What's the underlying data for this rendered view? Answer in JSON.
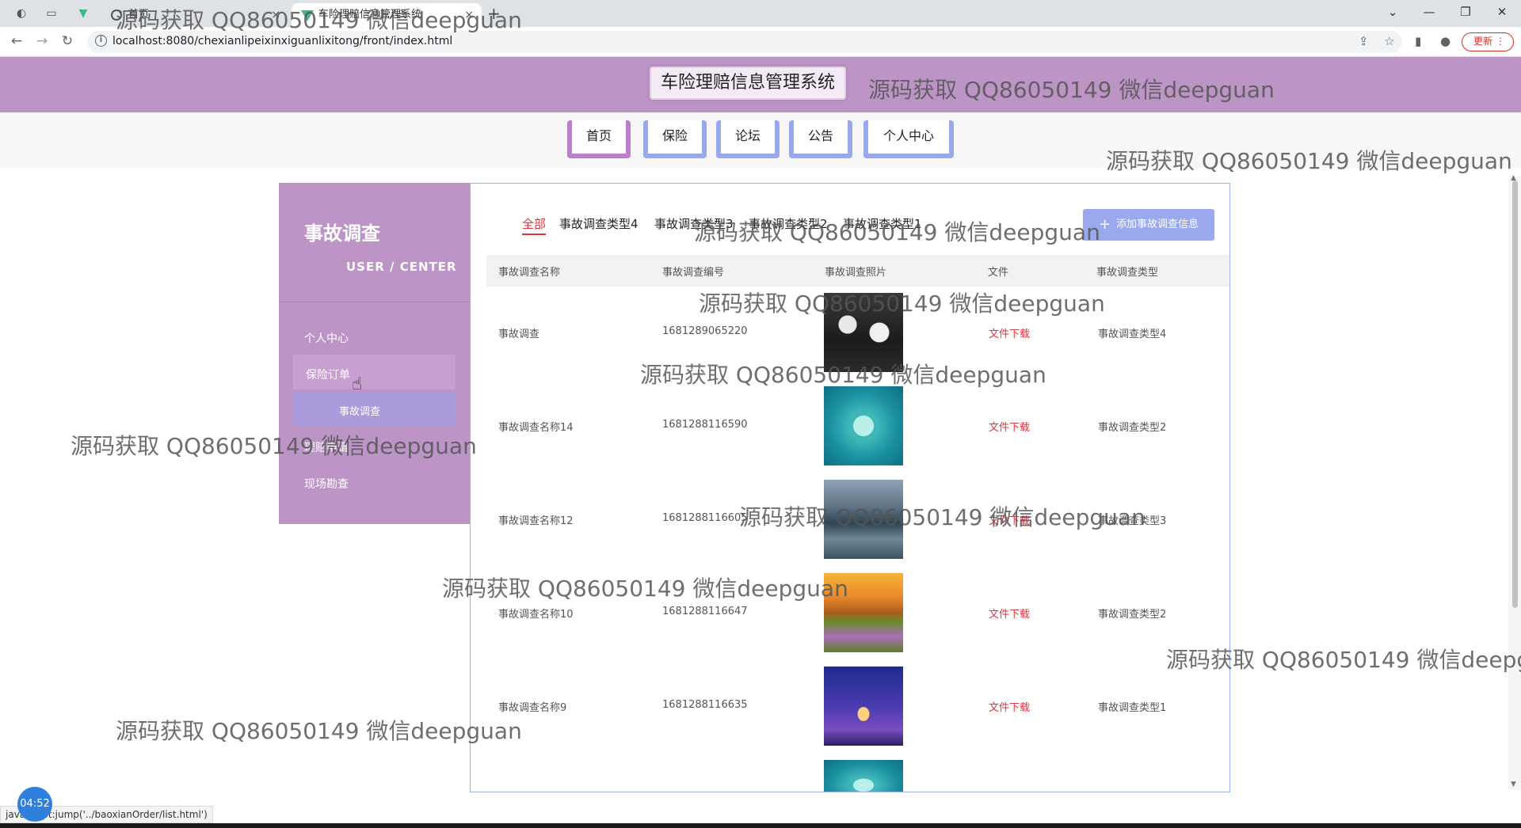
{
  "browser": {
    "tabs": [
      {
        "title": "首页",
        "close": "×"
      },
      {
        "title": "车险理赔信息管理系统",
        "close": "×"
      }
    ],
    "new_tab": "+",
    "window_controls": [
      "⌄",
      "—",
      "❐",
      "✕"
    ],
    "url": "localhost:8080/chexianlipeixinxiguanlixitong/front/index.html",
    "update_label": "更新",
    "icons": [
      "back-arrow-icon",
      "forward-arrow-icon",
      "reload-icon",
      "info-icon",
      "share-icon",
      "star-icon",
      "sidepanel-icon",
      "profile-icon",
      "menu-icon"
    ]
  },
  "header": {
    "title": "车险理赔信息管理系统"
  },
  "nav": {
    "items": [
      {
        "label": "首页"
      },
      {
        "label": "保险"
      },
      {
        "label": "论坛"
      },
      {
        "label": "公告"
      },
      {
        "label": "个人中心"
      }
    ]
  },
  "sidebar": {
    "title": "事故调查",
    "subtitle": "USER / CENTER",
    "items": [
      {
        "label": "个人中心"
      },
      {
        "label": "保险订单"
      },
      {
        "label": "事故调查"
      },
      {
        "label": "理赔申请"
      },
      {
        "label": "现场勘查"
      }
    ]
  },
  "filters": {
    "items": [
      {
        "label": "全部"
      },
      {
        "label": "事故调查类型4"
      },
      {
        "label": "事故调查类型3"
      },
      {
        "label": "事故调查类型2"
      },
      {
        "label": "事故调查类型1"
      }
    ],
    "active_index": 0
  },
  "add_button": {
    "label": "添加事故调查信息",
    "icon": "plus-icon"
  },
  "table": {
    "columns": [
      "事故调查名称",
      "事故调查编号",
      "事故调查照片",
      "文件",
      "事故调查类型"
    ],
    "rows": [
      {
        "name": "事故调查",
        "code": "1681289065220",
        "file": "文件下载",
        "type": "事故调查类型4",
        "photo": "basketball-players-photo"
      },
      {
        "name": "事故调查名称14",
        "code": "1681288116590",
        "file": "文件下载",
        "type": "事故调查类型2",
        "photo": "heart-island-photo"
      },
      {
        "name": "事故调查名称12",
        "code": "1681288116605",
        "file": "文件下载",
        "type": "事故调查类型3",
        "photo": "lake-mountain-photo"
      },
      {
        "name": "事故调查名称10",
        "code": "1681288116647",
        "file": "文件下载",
        "type": "事故调查类型2",
        "photo": "sunset-field-photo"
      },
      {
        "name": "事故调查名称9",
        "code": "1681288116635",
        "file": "文件下载",
        "type": "事故调查类型1",
        "photo": "eiffel-tower-photo"
      },
      {
        "name": "",
        "code": "",
        "file": "",
        "type": "",
        "photo": "heart-island-photo"
      }
    ]
  },
  "watermark": "源码获取 QQ86050149 微信deepguan",
  "status_text": "javascript:jump('../baoxianOrder/list.html')",
  "timer": "04:52",
  "colors": {
    "header_bg": "#bd94c6",
    "accent_blue": "#9aa9ee",
    "accent_red": "#e0353f"
  }
}
